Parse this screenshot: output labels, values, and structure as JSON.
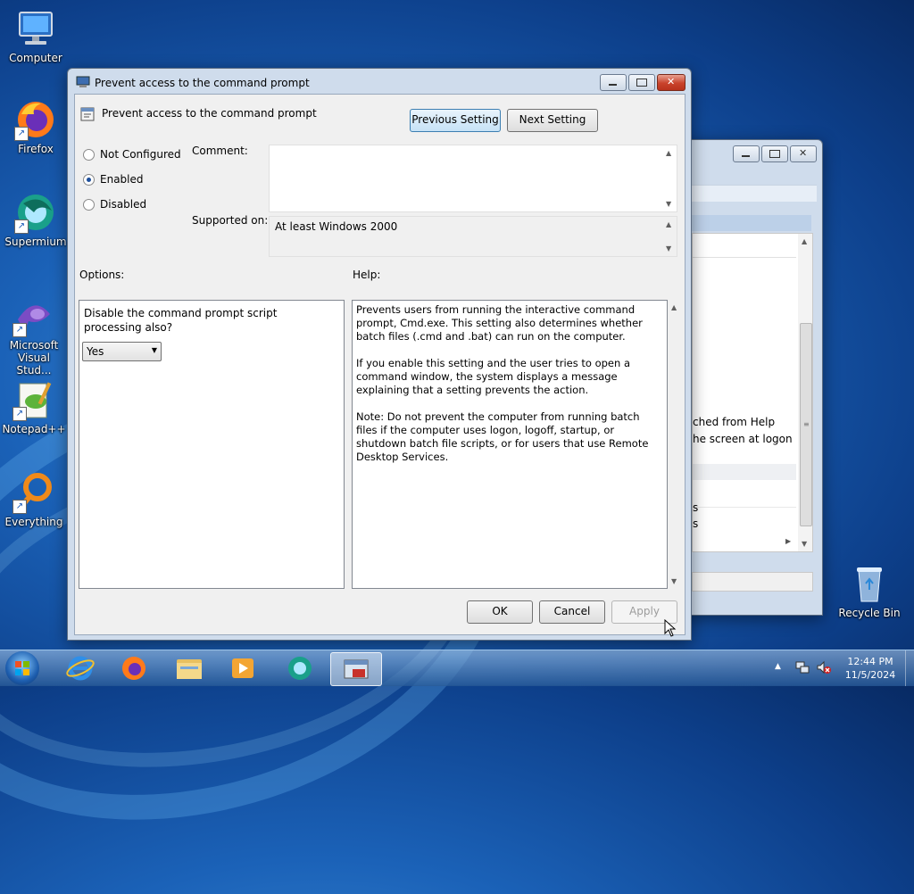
{
  "desktop": {
    "icons": [
      {
        "label": "Computer",
        "icon": "computer-icon"
      },
      {
        "label": "Firefox",
        "icon": "firefox-icon"
      },
      {
        "label": "Supermium",
        "icon": "supermium-icon"
      },
      {
        "label": "Microsoft Visual Stud...",
        "icon": "visual-studio-icon"
      },
      {
        "label": "Notepad++",
        "icon": "notepadpp-icon"
      },
      {
        "label": "Everything",
        "icon": "everything-icon"
      },
      {
        "label": "Recycle Bin",
        "icon": "recycle-bin-icon"
      }
    ]
  },
  "bg_window": {
    "text_line1": "ched from Help",
    "text_line2": "he screen at logon",
    "text_line3": "s",
    "text_line4": "s"
  },
  "dialog": {
    "title": "Prevent access to the command prompt",
    "setting_name": "Prevent access to the command prompt",
    "previous_setting": "Previous Setting",
    "next_setting": "Next Setting",
    "options": {
      "not_configured": "Not Configured",
      "enabled": "Enabled",
      "disabled": "Disabled",
      "selected": "Enabled"
    },
    "comment_label": "Comment:",
    "comment_value": "",
    "supported_label": "Supported on:",
    "supported_value": "At least Windows 2000",
    "options_label": "Options:",
    "help_label": "Help:",
    "option_question": "Disable the command prompt script processing also?",
    "option_select_value": "Yes",
    "help_text": "Prevents users from running the interactive command prompt, Cmd.exe. This setting also determines whether batch files (.cmd and .bat) can run on the computer.\n\nIf you enable this setting and the user tries to open a command window, the system displays a message explaining that a setting prevents the action.\n\nNote: Do not prevent the computer from running batch files if the computer uses logon, logoff, startup, or shutdown batch file scripts, or for users that use Remote Desktop Services.",
    "ok": "OK",
    "cancel": "Cancel",
    "apply": "Apply"
  },
  "taskbar": {
    "time": "12:44 PM",
    "date": "11/5/2024",
    "items": [
      "internet-explorer-icon",
      "firefox-icon",
      "file-explorer-icon",
      "media-player-icon",
      "supermium-icon",
      "group-policy-icon"
    ]
  },
  "colors": {
    "accent": "#1d4f9b",
    "close": "#c9422b"
  }
}
